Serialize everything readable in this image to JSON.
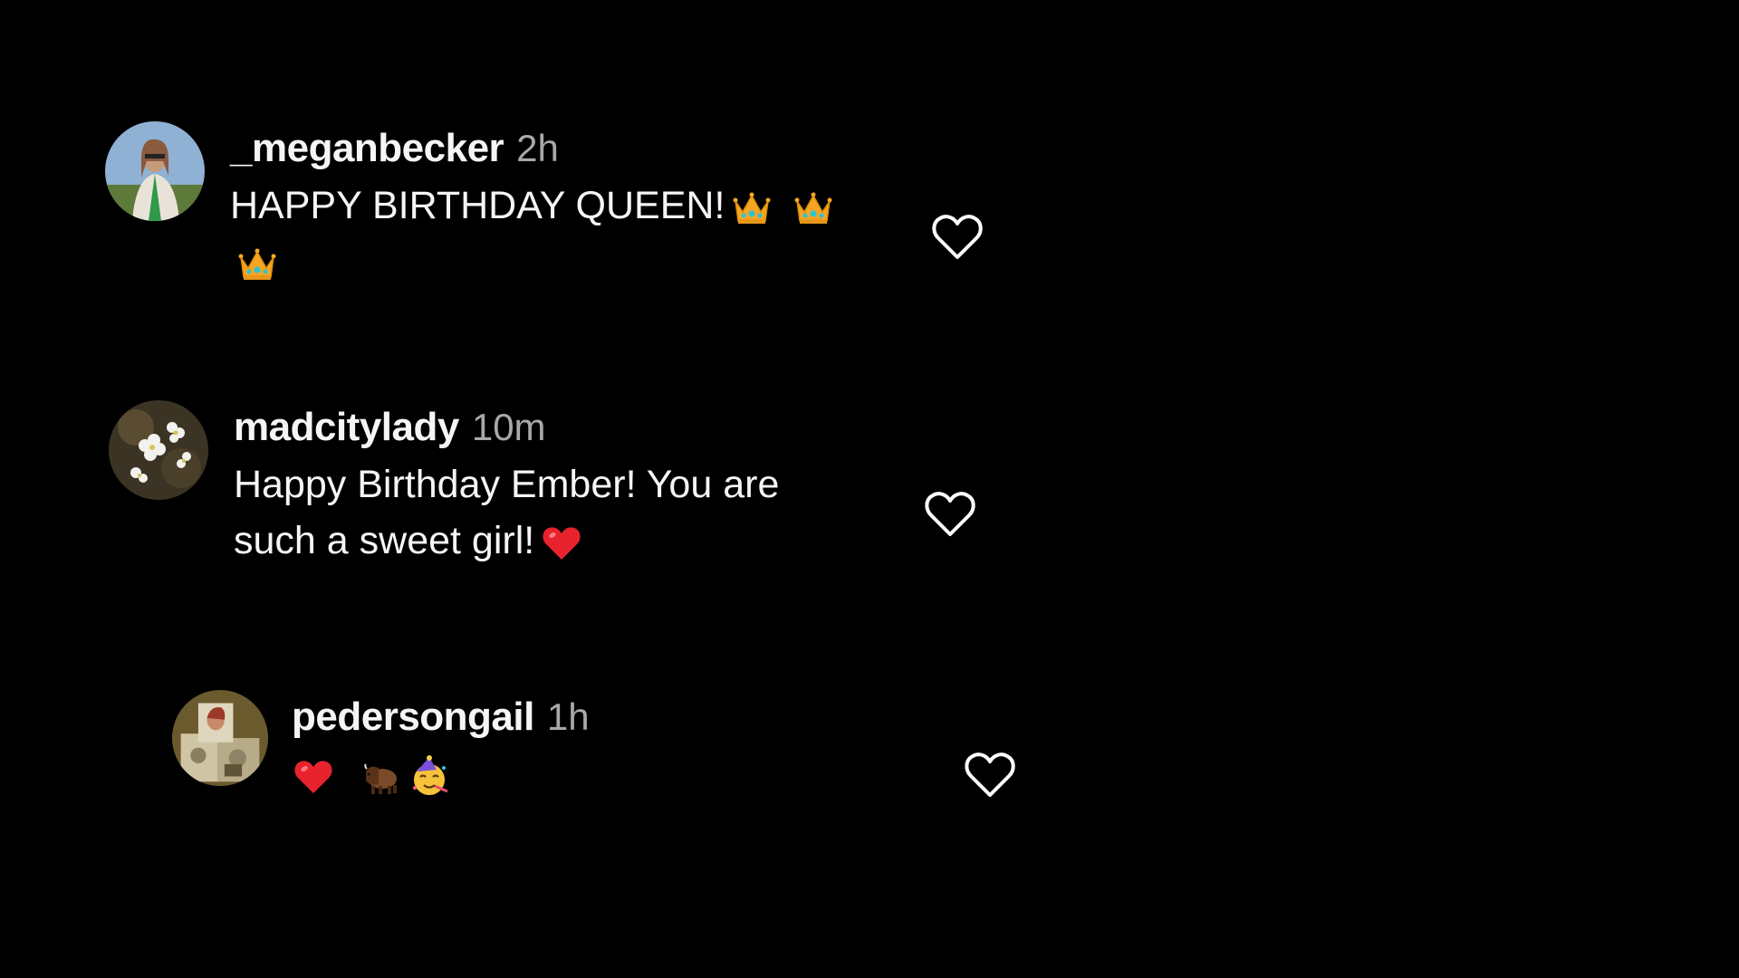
{
  "comments": [
    {
      "username": "_meganbecker",
      "time": "2h",
      "text": "HAPPY BIRTHDAY QUEEN!",
      "emojis": [
        "crown",
        "crown",
        "crown"
      ],
      "avatar_icon": "person-portrait"
    },
    {
      "username": "madcitylady",
      "time": "10m",
      "text_line1": "Happy Birthday Ember! You are",
      "text_line2": "such a sweet girl!",
      "emojis": [
        "red-heart"
      ],
      "avatar_icon": "white-flowers"
    },
    {
      "username": "pedersongail",
      "time": "1h",
      "emojis": [
        "red-heart",
        "bison",
        "partying-face"
      ],
      "avatar_icon": "collage-portrait"
    }
  ],
  "colors": {
    "background": "#000000",
    "text": "#f5f5f5",
    "secondary_text": "#a8a8a8",
    "like_icon": "#ffffff"
  },
  "icons": {
    "like": "heart-outline-icon"
  }
}
